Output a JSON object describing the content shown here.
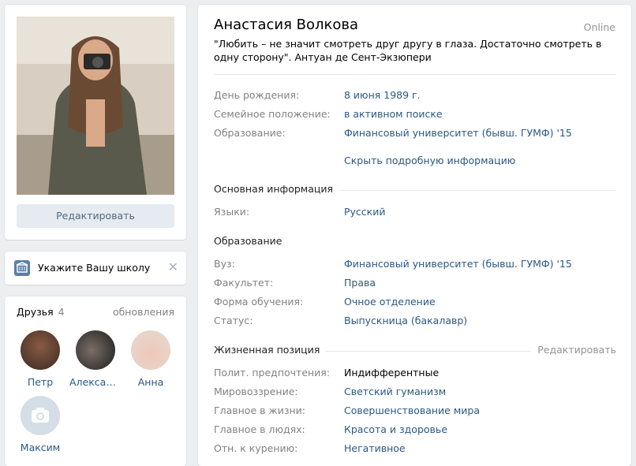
{
  "left": {
    "edit_button": "Редактировать",
    "school_prompt": "Укажите Вашу школу",
    "school_close": "✕",
    "friends": {
      "title": "Друзья",
      "count": "4",
      "updates": "обновления",
      "items": [
        {
          "name": "Петр"
        },
        {
          "name": "Александ..."
        },
        {
          "name": "Анна"
        },
        {
          "name": "Максим"
        }
      ]
    }
  },
  "profile": {
    "name": "Анастасия Волкова",
    "online": "Online",
    "status": "\"Любить – не значит смотреть друг другу в глаза. Достаточно смотреть в одну сторону\". Антуан де Сент-Экзюпери",
    "basic": [
      {
        "label": "День рождения:",
        "value": "8 июня 1989 г."
      },
      {
        "label": "Семейное положение:",
        "value": "в активном поиске"
      },
      {
        "label": "Образование:",
        "value": "Финансовый университет (бывш. ГУМФ) '15"
      }
    ],
    "hide_details": "Скрыть подробную информацию",
    "sections": {
      "main": {
        "title": "Основная информация",
        "rows": [
          {
            "label": "Языки:",
            "value": "Русский"
          }
        ]
      },
      "education": {
        "title": "Образование",
        "rows": [
          {
            "label": "Вуз:",
            "value": "Финансовый университет (бывш. ГУМФ) '15"
          },
          {
            "label": "Факультет:",
            "value": "Права"
          },
          {
            "label": "Форма обучения:",
            "value": "Очное отделение"
          },
          {
            "label": "Статус:",
            "value": "Выпускница (бакалавр)"
          }
        ]
      },
      "life": {
        "title": "Жизненная позиция",
        "action": "Редактировать",
        "rows": [
          {
            "label": "Полит. предпочтения:",
            "value": "Индифферентные"
          },
          {
            "label": "Мировоззрение:",
            "value": "Светский гуманизм"
          },
          {
            "label": "Главное в жизни:",
            "value": "Совершенствование мира"
          },
          {
            "label": "Главное в людях:",
            "value": "Красота и здоровье"
          },
          {
            "label": "Отн. к курению:",
            "value": "Негативное"
          }
        ]
      }
    }
  },
  "colors": {
    "link": "#2a5885",
    "label": "#828282",
    "background": "#edeef0",
    "button": "#e5ebf1"
  }
}
